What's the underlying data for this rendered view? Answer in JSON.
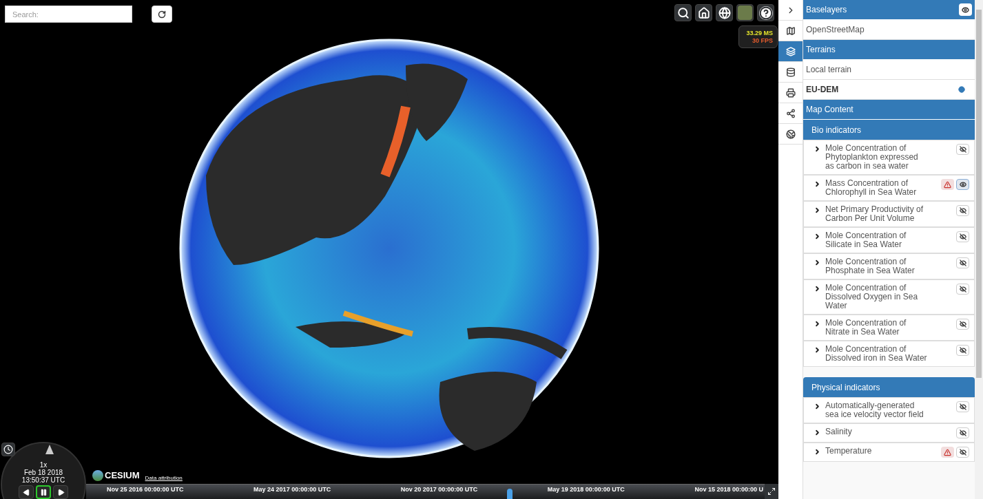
{
  "search": {
    "placeholder": "Search:"
  },
  "toolbar": {
    "buttons": [
      {
        "kind": "search"
      },
      {
        "kind": "home"
      },
      {
        "kind": "globe"
      },
      {
        "kind": "imagery"
      },
      {
        "kind": "help"
      }
    ]
  },
  "performance": {
    "ms": "33.29 MS",
    "fps": "30 FPS"
  },
  "animation": {
    "speed": "1x",
    "date": "Feb 18 2018",
    "time": "13:50:37 UTC",
    "playing": true
  },
  "credits": {
    "logo": "CESIUM",
    "attribution": "Data attribution"
  },
  "timeline": {
    "labels": [
      "Nov 25 2016 00:00:00 UTC",
      "May 24 2017 00:00:00 UTC",
      "Nov 20 2017 00:00:00 UTC",
      "May 19 2018 00:00:00 UTC",
      "Nov 15 2018 00:00:00 U"
    ],
    "level": 0.62
  },
  "side_tabs": [
    {
      "kind": "collapse",
      "selected": false
    },
    {
      "kind": "map",
      "selected": false
    },
    {
      "kind": "layers",
      "selected": true
    },
    {
      "kind": "database",
      "selected": false
    },
    {
      "kind": "print",
      "selected": false
    },
    {
      "kind": "share",
      "selected": false
    },
    {
      "kind": "globe",
      "selected": false
    }
  ],
  "baselayers": {
    "title": "Baselayers",
    "items": [
      {
        "label": "OpenStreetMap",
        "selected": false
      }
    ]
  },
  "terrains": {
    "title": "Terrains",
    "items": [
      {
        "label": "Local terrain",
        "selected": false
      },
      {
        "label": "EU-DEM",
        "selected": true
      }
    ]
  },
  "map_content": {
    "title": "Map Content",
    "groups": [
      {
        "title": "Bio indicators",
        "layers": [
          {
            "name": "Mole Concentration of Phytoplankton expressed as carbon in sea water",
            "warning": false,
            "visible": false
          },
          {
            "name": "Mass Concentration of Chlorophyll in Sea Water",
            "warning": true,
            "visible": true
          },
          {
            "name": "Net Primary Productivity of Carbon Per Unit Volume",
            "warning": false,
            "visible": false
          },
          {
            "name": "Mole Concentration of Silicate in Sea Water",
            "warning": false,
            "visible": false
          },
          {
            "name": "Mole Concentration of Phosphate in Sea Water",
            "warning": false,
            "visible": false
          },
          {
            "name": "Mole Concentration of Dissolved Oxygen in Sea Water",
            "warning": false,
            "visible": false
          },
          {
            "name": "Mole Concentration of Nitrate in Sea Water",
            "warning": false,
            "visible": false
          },
          {
            "name": "Mole Concentration of Dissolved iron in Sea Water",
            "warning": false,
            "visible": false
          }
        ]
      },
      {
        "title": "Physical indicators",
        "layers": [
          {
            "name": "Automatically-generated sea ice velocity vector field",
            "warning": false,
            "visible": false
          },
          {
            "name": "Salinity",
            "warning": false,
            "visible": false
          },
          {
            "name": "Temperature",
            "warning": true,
            "visible": false
          }
        ]
      }
    ]
  }
}
